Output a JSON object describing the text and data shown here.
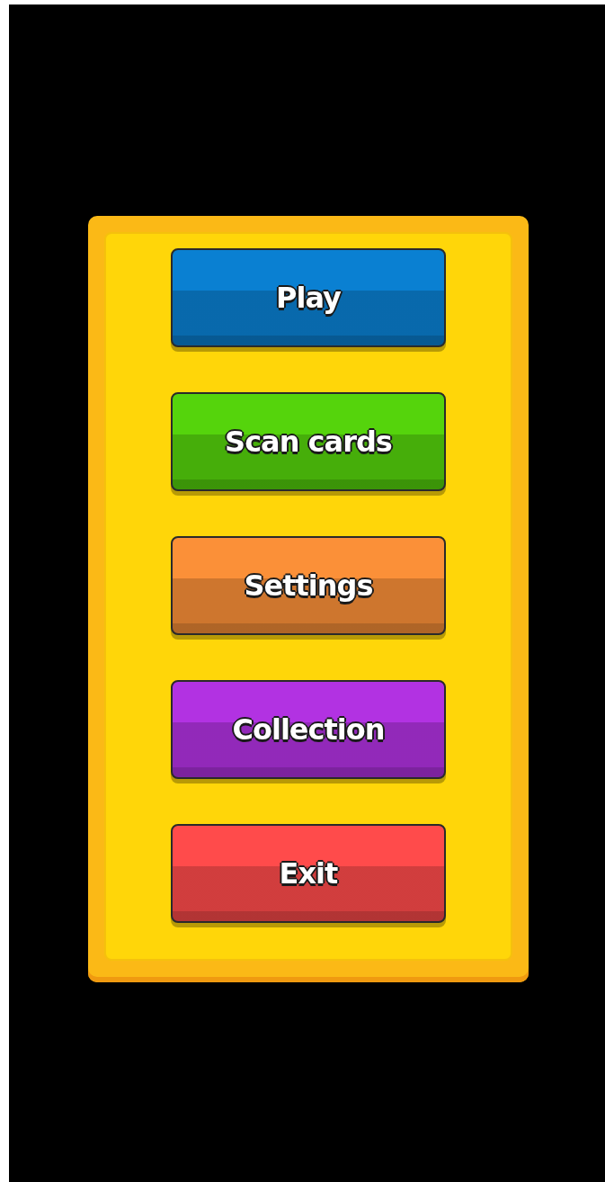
{
  "menu": {
    "buttons": [
      {
        "label": "Play",
        "color": "#0a80d2"
      },
      {
        "label": "Scan cards",
        "color": "#55d40c"
      },
      {
        "label": "Settings",
        "color": "#fb9038"
      },
      {
        "label": "Collection",
        "color": "#b232e2"
      },
      {
        "label": "Exit",
        "color": "#ff4b4b"
      }
    ]
  }
}
